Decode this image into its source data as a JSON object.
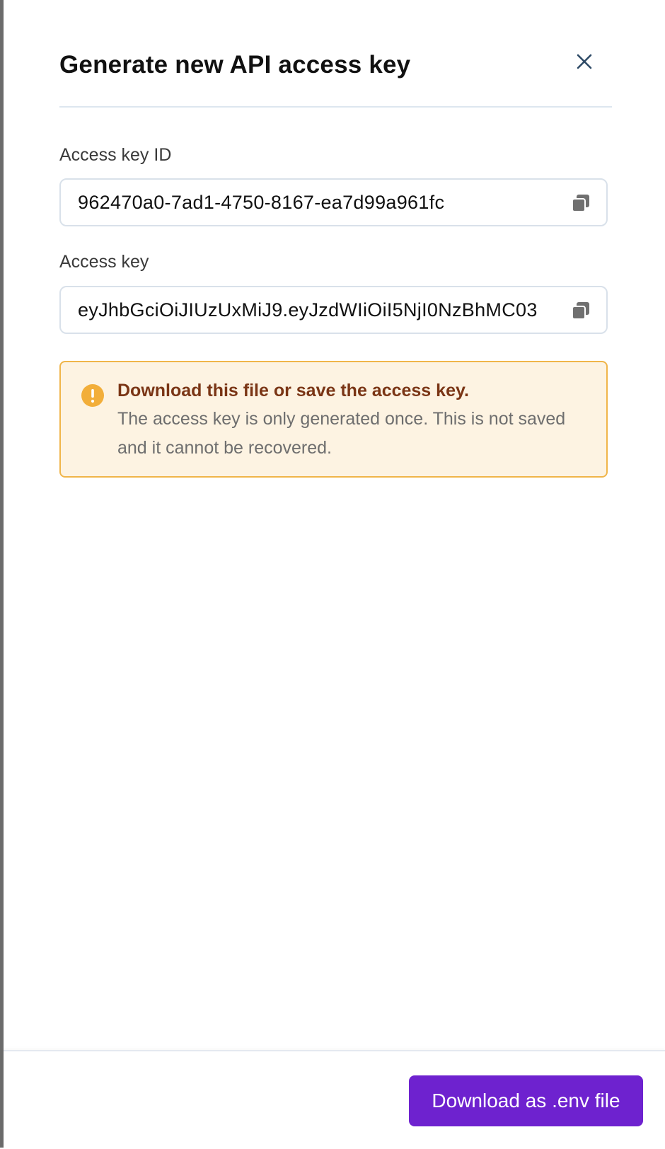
{
  "dialog": {
    "title": "Generate new API access key",
    "close_icon": "close-icon"
  },
  "fields": [
    {
      "label": "Access key ID",
      "value": "962470a0-7ad1-4750-8167-ea7d99a961fc",
      "copy_icon": "copy-icon"
    },
    {
      "label": "Access key",
      "value": "eyJhbGciOiJIUzUxMiJ9.eyJzdWIiOiI5NjI0NzBhMC03",
      "copy_icon": "copy-icon"
    }
  ],
  "alert": {
    "icon": "warning-icon",
    "title": "Download this file or save the access key.",
    "body": "The access key is only generated once. This is not saved and it cannot be recovered."
  },
  "footer": {
    "download_label": "Download as .env file"
  },
  "colors": {
    "accent": "#6e22cf",
    "warning_border": "#f0b549",
    "warning_bg": "#fdf3e2",
    "warning_title": "#7a3515",
    "warning_icon": "#f2ae3a"
  }
}
